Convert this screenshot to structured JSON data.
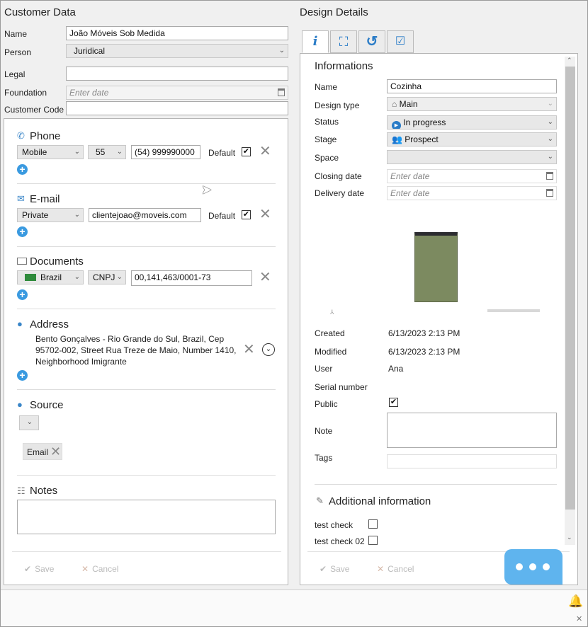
{
  "customer": {
    "title": "Customer Data",
    "name_label": "Name",
    "name_value": "João Móveis Sob Medida",
    "person_label": "Person",
    "person_value": "Juridical",
    "legal_label": "Legal",
    "legal_value": "",
    "foundation_label": "Foundation",
    "foundation_placeholder": "Enter date",
    "code_label": "Customer Code",
    "code_value": ""
  },
  "phone": {
    "title": "Phone",
    "type": "Mobile",
    "country_code": "55",
    "number": "(54) 999990000",
    "default_label": "Default",
    "default_checked": true
  },
  "email": {
    "title": "E-mail",
    "type": "Private",
    "address": "clientejoao@moveis.com",
    "default_label": "Default",
    "default_checked": true
  },
  "documents": {
    "title": "Documents",
    "country": "Brazil",
    "doc_type": "CNPJ",
    "number": "00,141,463/0001-73"
  },
  "address": {
    "title": "Address",
    "line1": "Bento Gonçalves - Rio Grande do Sul, Brazil, Cep",
    "line2": "95702-002, Street Rua Treze de Maio, Number 1410,",
    "line3": "Neighborhood Imigrante"
  },
  "source": {
    "title": "Source",
    "tag": "Email"
  },
  "notes": {
    "title": "Notes",
    "value": ""
  },
  "left_actions": {
    "save": "Save",
    "cancel": "Cancel"
  },
  "design": {
    "title": "Design Details",
    "section_title": "Informations",
    "name_label": "Name",
    "name_value": "Cozinha",
    "design_type_label": "Design type",
    "design_type_value": "Main",
    "status_label": "Status",
    "status_value": "In progress",
    "stage_label": "Stage",
    "stage_value": "Prospect",
    "space_label": "Space",
    "space_value": "",
    "closing_label": "Closing date",
    "closing_placeholder": "Enter date",
    "delivery_label": "Delivery date",
    "delivery_placeholder": "Enter date",
    "created_label": "Created",
    "created_value": "6/13/2023 2:13 PM",
    "modified_label": "Modified",
    "modified_value": "6/13/2023 2:13 PM",
    "user_label": "User",
    "user_value": "Ana",
    "serial_label": "Serial number",
    "public_label": "Public",
    "public_checked": true,
    "note_label": "Note",
    "tags_label": "Tags",
    "additional_title": "Additional information",
    "test_check_label": "test check",
    "test_check02_label": "test check 02"
  },
  "right_actions": {
    "save": "Save",
    "cancel": "Cancel"
  },
  "colors": {
    "accent": "#3a9ae0",
    "preview_green": "#7c8a60",
    "chat": "#5fb4ee"
  }
}
